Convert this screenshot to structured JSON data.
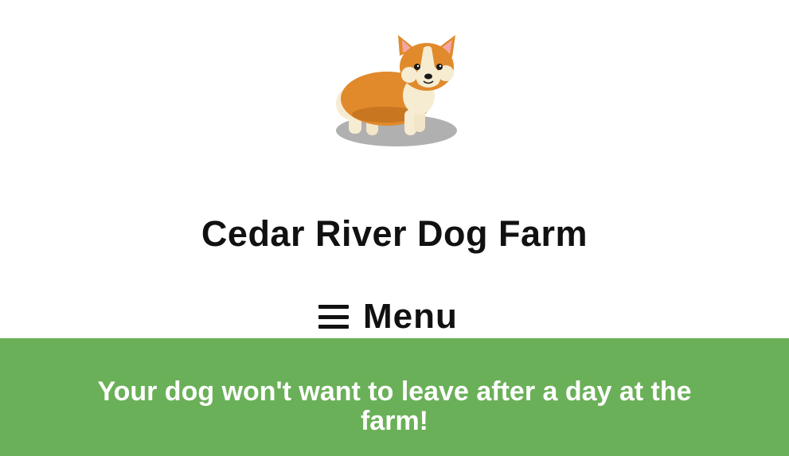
{
  "header": {
    "logo_icon": "corgi-dog-logo",
    "site_title": "Cedar River Dog Farm"
  },
  "nav": {
    "menu_icon": "hamburger-icon",
    "menu_label": "Menu"
  },
  "banner": {
    "text": "Your dog won't want to leave after a day at the farm!",
    "background_color": "#6ab058",
    "text_color": "#ffffff"
  }
}
